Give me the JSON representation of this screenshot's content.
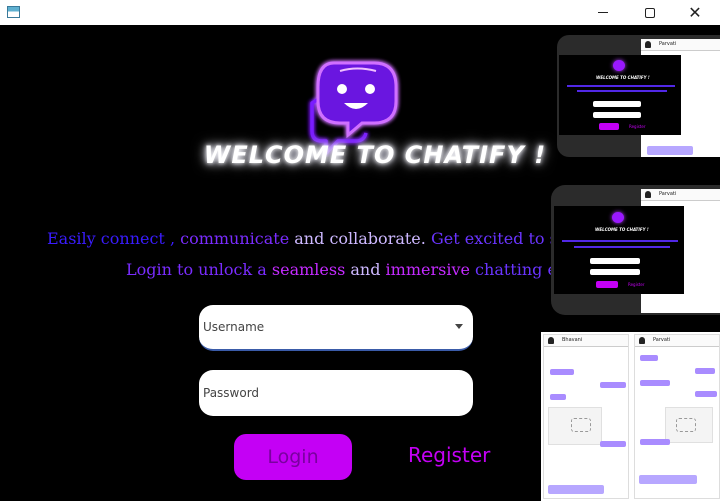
{
  "window": {
    "minimize_glyph": "",
    "maximize_glyph": "",
    "close_glyph": "✕"
  },
  "welcome": {
    "title": "WELCOME TO  CHATIFY !"
  },
  "tagline": {
    "line1": [
      {
        "text": "Easily connect , ",
        "color": "#3a1cff"
      },
      {
        "text": "communicate ",
        "color": "#7a2cff"
      },
      {
        "text": "and collaborate. ",
        "color": "#cdb8ff"
      },
      {
        "text": "Get excited to start",
        "color": "#6a34ff"
      }
    ],
    "line2": [
      {
        "text": "Login ",
        "color": "#7a2cff"
      },
      {
        "text": "to unlock a ",
        "color": "#7a2cff"
      },
      {
        "text": "seamless ",
        "color": "#c42bff"
      },
      {
        "text": "and ",
        "color": "#cdb8ff"
      },
      {
        "text": "immersive ",
        "color": "#c42bff"
      },
      {
        "text": "chatting exp",
        "color": "#6a34ff"
      }
    ]
  },
  "form": {
    "username_placeholder": "Username",
    "username_value": "",
    "password_placeholder": "Password",
    "password_value": "",
    "login_label": "Login",
    "register_label": "Register"
  },
  "previews": {
    "chat_header_name": "Parvati",
    "chat_header_name_2": "Bhavani",
    "mini_welcome": "WELCOME TO CHATIFY !",
    "mini_register": "Register"
  },
  "colors": {
    "accent": "#c400f5",
    "background": "#000000",
    "logo_glow": "#b03cff"
  }
}
